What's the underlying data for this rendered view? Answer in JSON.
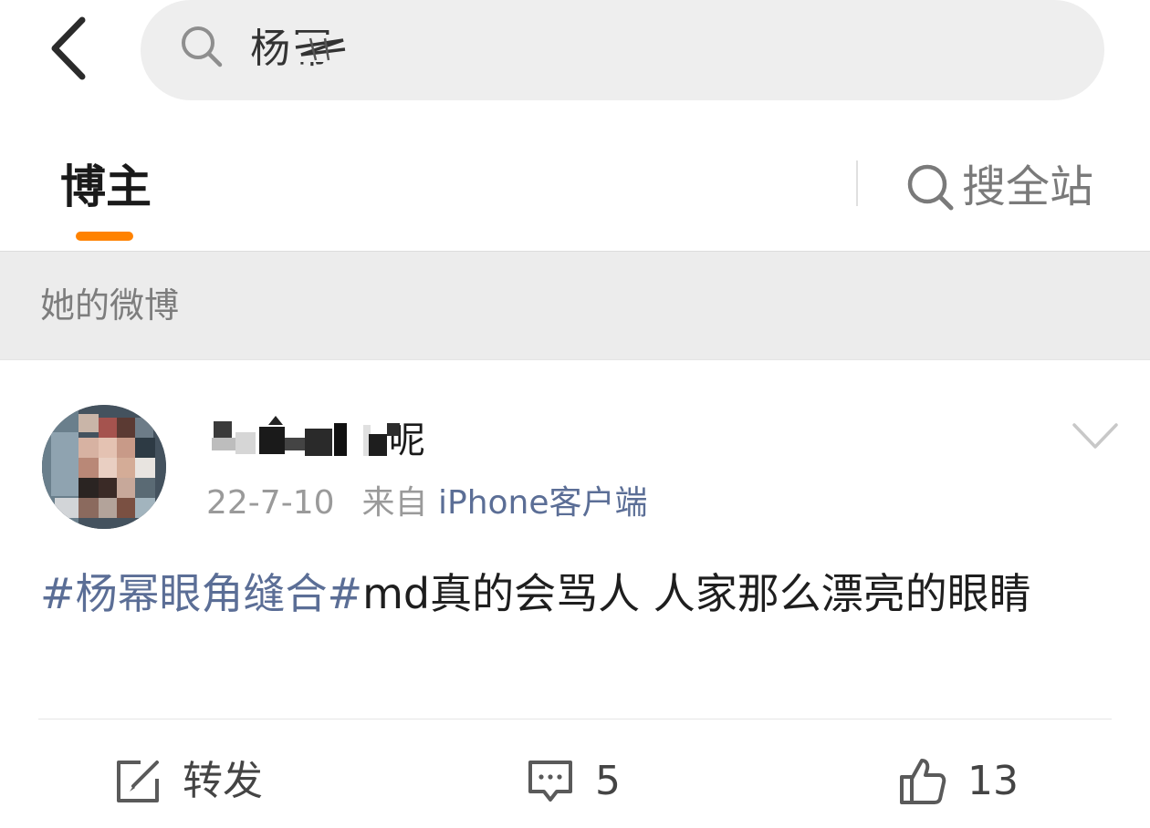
{
  "search": {
    "query": "杨幂"
  },
  "tabs": {
    "active_label": "博主",
    "site_search_label": "搜全站"
  },
  "section": {
    "title": "她的微博"
  },
  "post": {
    "author_name": "呢",
    "date": "22-7-10",
    "from_label": "来自",
    "source": "iPhone客户端",
    "topic": "#杨幂眼角缝合#",
    "text": "md真的会骂人 人家那么漂亮的眼睛",
    "actions": {
      "repost_label": "转发",
      "comment_count": "5",
      "like_count": "13"
    }
  },
  "colors": {
    "accent": "#ff8200",
    "link": "#5b6e96"
  }
}
